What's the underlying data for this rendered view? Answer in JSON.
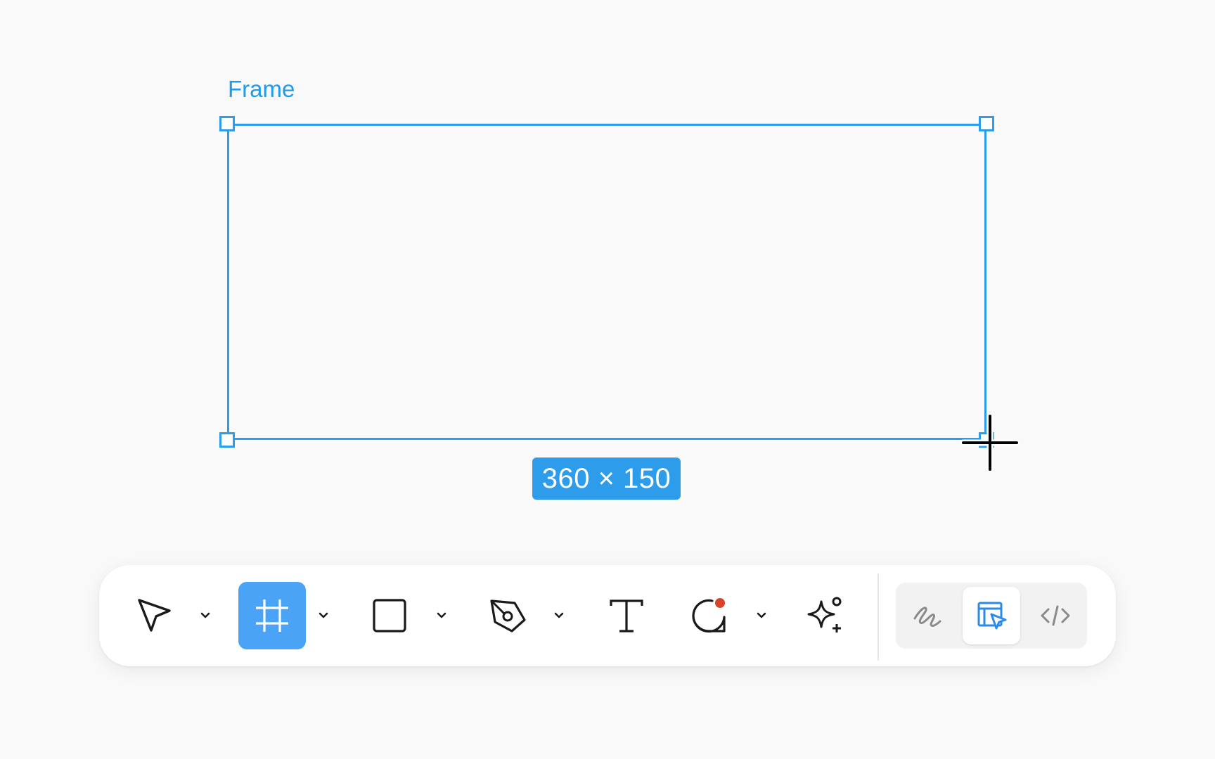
{
  "canvas": {
    "frame": {
      "label": "Frame",
      "dimensions": "360 × 150",
      "accent_color": "#2d9ceb"
    },
    "cursor": "crosshair-cursor"
  },
  "toolbar": {
    "tools": [
      {
        "name": "move-tool",
        "icon": "pointer-arrow-icon",
        "has_dropdown": true,
        "active": false
      },
      {
        "name": "frame-tool",
        "icon": "hash-frame-icon",
        "has_dropdown": true,
        "active": true
      },
      {
        "name": "rectangle-tool",
        "icon": "square-icon",
        "has_dropdown": true,
        "active": false
      },
      {
        "name": "pen-tool",
        "icon": "pen-nib-icon",
        "has_dropdown": true,
        "active": false
      },
      {
        "name": "text-tool",
        "icon": "text-t-icon",
        "has_dropdown": false,
        "active": false
      },
      {
        "name": "comment-tool",
        "icon": "comment-bubble-icon",
        "has_dropdown": true,
        "active": false
      },
      {
        "name": "actions-tool",
        "icon": "sparkle-plus-icon",
        "has_dropdown": false,
        "active": false
      }
    ],
    "modes": [
      {
        "name": "draw-mode",
        "icon": "squiggle-icon",
        "active": false
      },
      {
        "name": "design-mode",
        "icon": "design-cursor-icon",
        "active": true
      },
      {
        "name": "dev-mode",
        "icon": "code-brackets-icon",
        "active": false
      }
    ],
    "active_color": "#4aa3f5",
    "notification_color": "#d9432b"
  }
}
